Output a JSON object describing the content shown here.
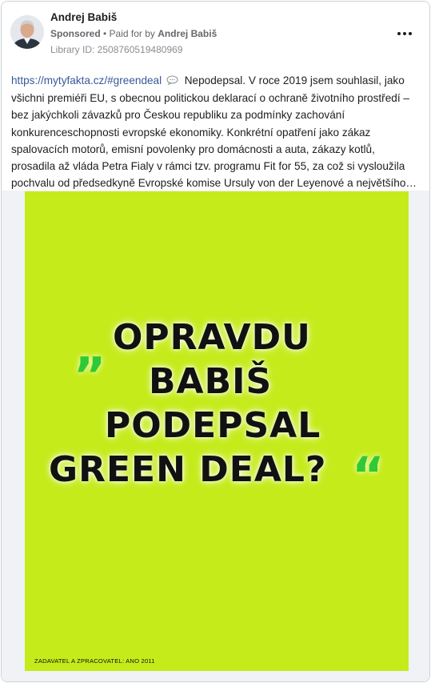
{
  "post": {
    "page_name": "Andrej Babiš",
    "sponsored": "Sponsored",
    "paid_prefix": " • Paid for by ",
    "payer": "Andrej Babiš",
    "library_id": "Library ID: 2508760519480969",
    "link": "https://mytyfakta.cz/#greendeal",
    "icon": "speech-bubble-icon",
    "body": "Nepodepsal. V roce 2019 jsem souhlasil, jako všichni premiéři EU, s obecnou politickou deklarací o ochraně životního prostředí – bez jakýchkoli závazků pro Českou republiku za podmínky zachování konkurenceschopnosti evropské ekonomiky. Konkrétní opatření jako zákaz spalovacích motorů, emisní povolenky pro domácnosti a auta, zákazy kotlů, prosadila až vláda Petra Fialy v rámci tzv. programu Fit for 55, za což si vysloužila pochvalu od předsedkyně Evropské komise Ursuly von der Leyenové a největšího…"
  },
  "creative": {
    "background": "#c5eb1a",
    "quote_color": "#2fc935",
    "quote_open": "„",
    "quote_close": "“",
    "headline": [
      "OPRAVDU",
      "BABIŠ",
      "PODEPSAL",
      "GREEN DEAL?"
    ],
    "credit": "ZADAVATEL A ZPRACOVATEL: ANO 2011"
  }
}
